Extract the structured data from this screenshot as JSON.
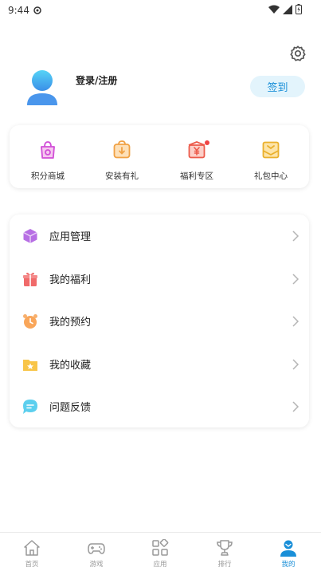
{
  "status_bar": {
    "time": "9:44"
  },
  "profile": {
    "login_label": "登录/注册",
    "signin_label": "签到"
  },
  "quick_links": [
    {
      "label": "积分商城",
      "icon": "shopping-bag-icon"
    },
    {
      "label": "安装有礼",
      "icon": "install-gift-icon"
    },
    {
      "label": "福利专区",
      "icon": "welfare-zone-icon"
    },
    {
      "label": "礼包中心",
      "icon": "gift-package-icon"
    }
  ],
  "menu": [
    {
      "label": "应用管理",
      "icon": "cube-icon"
    },
    {
      "label": "我的福利",
      "icon": "gift-box-icon"
    },
    {
      "label": "我的预约",
      "icon": "alarm-clock-icon"
    },
    {
      "label": "我的收藏",
      "icon": "star-folder-icon"
    },
    {
      "label": "问题反馈",
      "icon": "chat-bubble-icon"
    }
  ],
  "bottom_nav": [
    {
      "label": "首页",
      "icon": "home-icon"
    },
    {
      "label": "游戏",
      "icon": "gamepad-icon"
    },
    {
      "label": "应用",
      "icon": "apps-grid-icon"
    },
    {
      "label": "排行",
      "icon": "trophy-icon"
    },
    {
      "label": "我的",
      "icon": "user-icon",
      "active": true
    }
  ],
  "colors": {
    "accent": "#1a8fd8",
    "signin_bg": "#e3f4fc"
  }
}
